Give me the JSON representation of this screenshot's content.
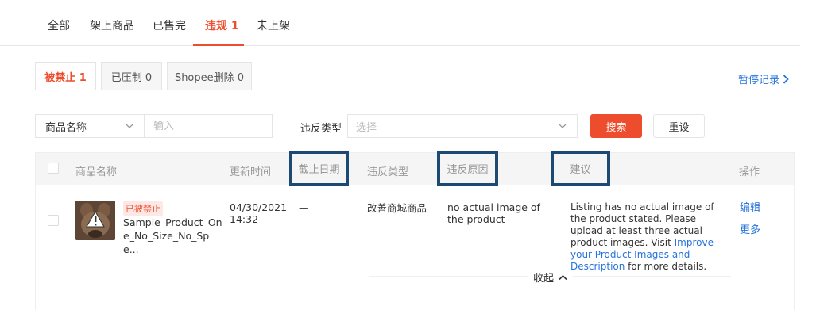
{
  "top_tabs": [
    {
      "label": "全部",
      "active": false
    },
    {
      "label": "架上商品",
      "active": false
    },
    {
      "label": "已售完",
      "active": false
    },
    {
      "label": "违规 1",
      "active": true
    },
    {
      "label": "未上架",
      "active": false
    }
  ],
  "sub_tabs": [
    {
      "label": "被禁止 1",
      "active": true
    },
    {
      "label": "已压制 0",
      "active": false
    },
    {
      "label": "Shopee删除 0",
      "active": false
    }
  ],
  "pause_record": "暂停记录",
  "filters": {
    "field_select": "商品名称",
    "input_placeholder": "输入",
    "violation_type_label": "违反类型",
    "violation_type_placeholder": "选择",
    "search_button": "搜索",
    "reset_button": "重设"
  },
  "table": {
    "headers": {
      "product_name": "商品名称",
      "update_time": "更新时间",
      "deadline": "截止日期",
      "violation_type": "违反类型",
      "violation_reason": "违反原因",
      "suggestion": "建议",
      "actions": "操作"
    },
    "row": {
      "status_badge": "已被禁止",
      "product_name": "Sample_Product_One_No_Size_No_Spe...",
      "update_date": "04/30/2021",
      "update_time": "14:32",
      "deadline": "—",
      "violation_type": "改善商城商品",
      "violation_reason": "no actual image of the product",
      "suggestion_text": "Listing has no actual image of the product stated. Please upload at least three actual product images. Visit",
      "suggestion_link": "Improve your Product Images and Description",
      "suggestion_tail": "for more details.",
      "action_edit": "编辑",
      "action_more": "更多",
      "collapse": "收起"
    }
  },
  "colors": {
    "accent": "#ee4d2d",
    "link": "#2673dd",
    "highlight_box": "#1c4a73"
  }
}
